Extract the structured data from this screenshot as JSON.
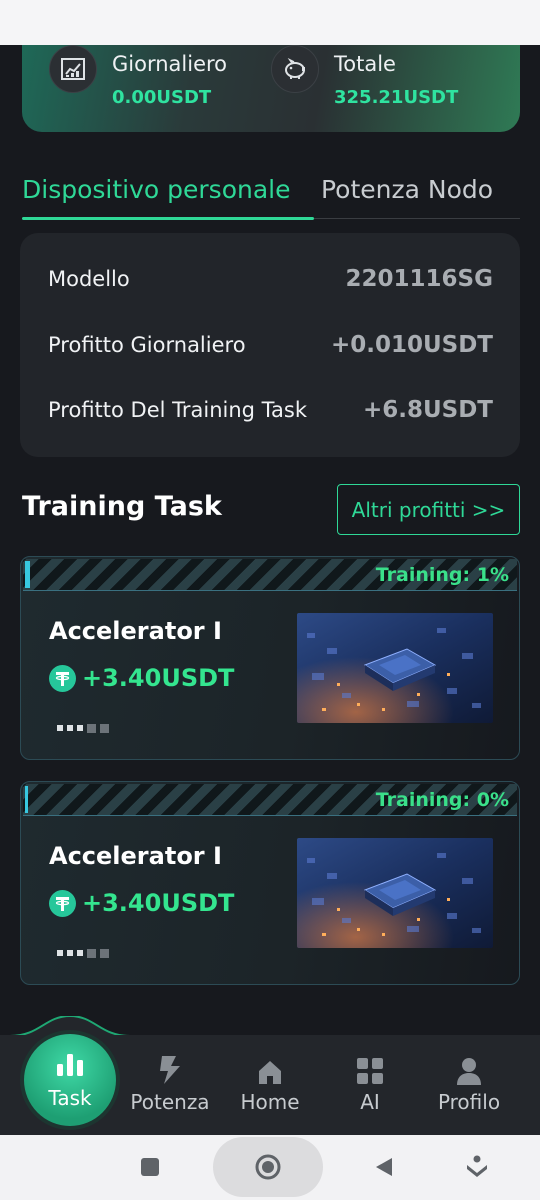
{
  "earnings": {
    "daily": {
      "label": "Giornaliero",
      "value": "0.00USDT",
      "icon": "chart-icon"
    },
    "total": {
      "label": "Totale",
      "value": "325.21USDT",
      "icon": "piggy-bank-icon"
    }
  },
  "tabs": [
    {
      "label": "Dispositivo personale",
      "active": true
    },
    {
      "label": "Potenza Nodo",
      "active": false
    }
  ],
  "device_info": [
    {
      "label": "Modello",
      "value": "2201116SG"
    },
    {
      "label": "Profitto Giornaliero",
      "value": "+0.010USDT"
    },
    {
      "label": "Profitto Del Training Task",
      "value": "+6.8USDT"
    }
  ],
  "training": {
    "title": "Training Task",
    "more_button": "Altri profitti >>",
    "tasks": [
      {
        "status": "Training: 1%",
        "progress": 0.01,
        "name": "Accelerator I",
        "reward": "+3.40USDT"
      },
      {
        "status": "Training: 0%",
        "progress": 0.0,
        "name": "Accelerator I",
        "reward": "+3.40USDT"
      }
    ]
  },
  "nav": {
    "items": [
      {
        "label": "Task",
        "icon": "bar-chart-icon",
        "active": true
      },
      {
        "label": "Potenza",
        "icon": "lightning-icon",
        "active": false
      },
      {
        "label": "Home",
        "icon": "home-icon",
        "active": false
      },
      {
        "label": "AI",
        "icon": "grid-icon",
        "active": false
      },
      {
        "label": "Profilo",
        "icon": "user-icon",
        "active": false
      }
    ]
  },
  "colors": {
    "accent": "#2fd897",
    "background": "#17191e",
    "card": "#22252a"
  }
}
